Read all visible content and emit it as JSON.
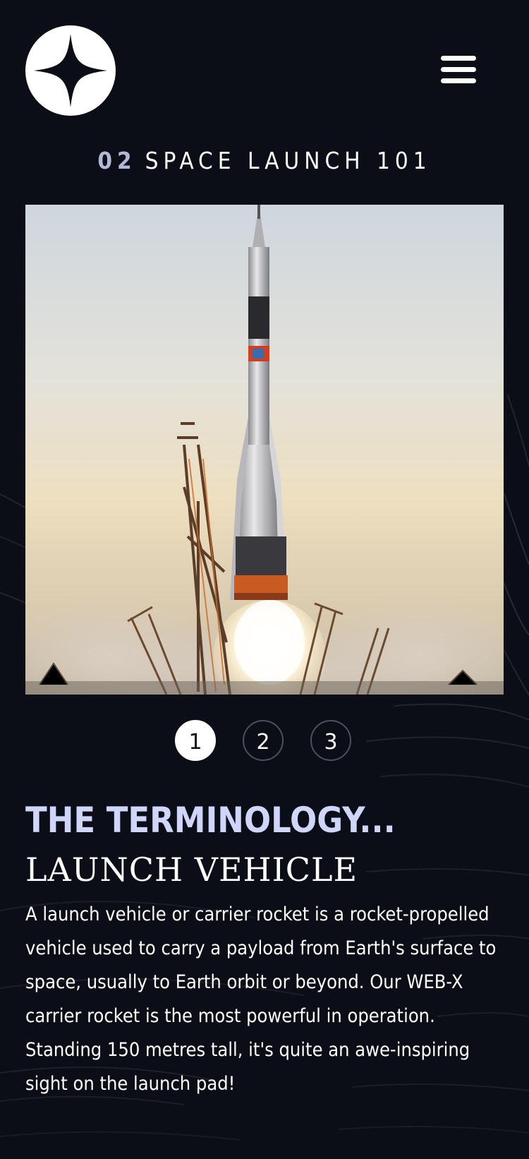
{
  "header": {
    "logo_icon": "four-point-star-icon",
    "menu_icon": "hamburger-menu-icon"
  },
  "page": {
    "number": "02",
    "title": "SPACE LAUNCH 101"
  },
  "hero_image": {
    "subject": "rocket-launch-photo"
  },
  "slides": {
    "items": [
      {
        "label": "1",
        "active": true
      },
      {
        "label": "2",
        "active": false
      },
      {
        "label": "3",
        "active": false
      }
    ]
  },
  "content": {
    "section_label": "THE TERMINOLOGY...",
    "term": "LAUNCH VEHICLE",
    "body": "A launch vehicle or carrier rocket is a rocket-propelled vehicle used to carry a payload from Earth's surface to space, usually to Earth orbit or beyond. Our WEB-X carrier rocket is the most powerful in operation. Standing 150 metres tall, it's quite an awe-inspiring sight on the launch pad!"
  },
  "colors": {
    "background": "#0b0d17",
    "accent": "#d0d6f9",
    "text": "#ffffff"
  }
}
